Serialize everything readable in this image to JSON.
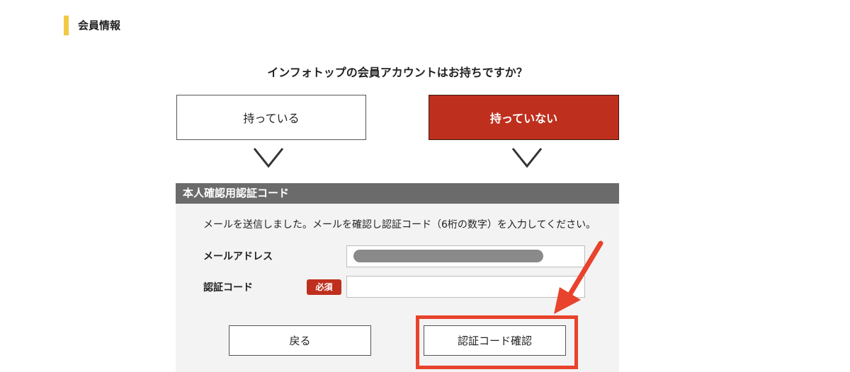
{
  "section": {
    "title": "会員情報"
  },
  "question": "インフォトップの会員アカウントはお持ちですか？",
  "choices": {
    "have": "持っている",
    "not_have": "持っていない",
    "selected": "not_have"
  },
  "verification_panel": {
    "header": "本人確認用認証コード",
    "instruction": "メールを送信しました。メールを確認し認証コード（6桁の数字）を入力してください。",
    "email_label": "メールアドレス",
    "email_value": "",
    "code_label": "認証コード",
    "required_badge": "必須",
    "code_value": "",
    "back_button": "戻る",
    "verify_button": "認証コード確認"
  },
  "colors": {
    "accent_yellow": "#f1c944",
    "selected_red": "#bf2f1d",
    "panel_header_gray": "#6b6b6b",
    "annotation_red": "#e8432d"
  }
}
